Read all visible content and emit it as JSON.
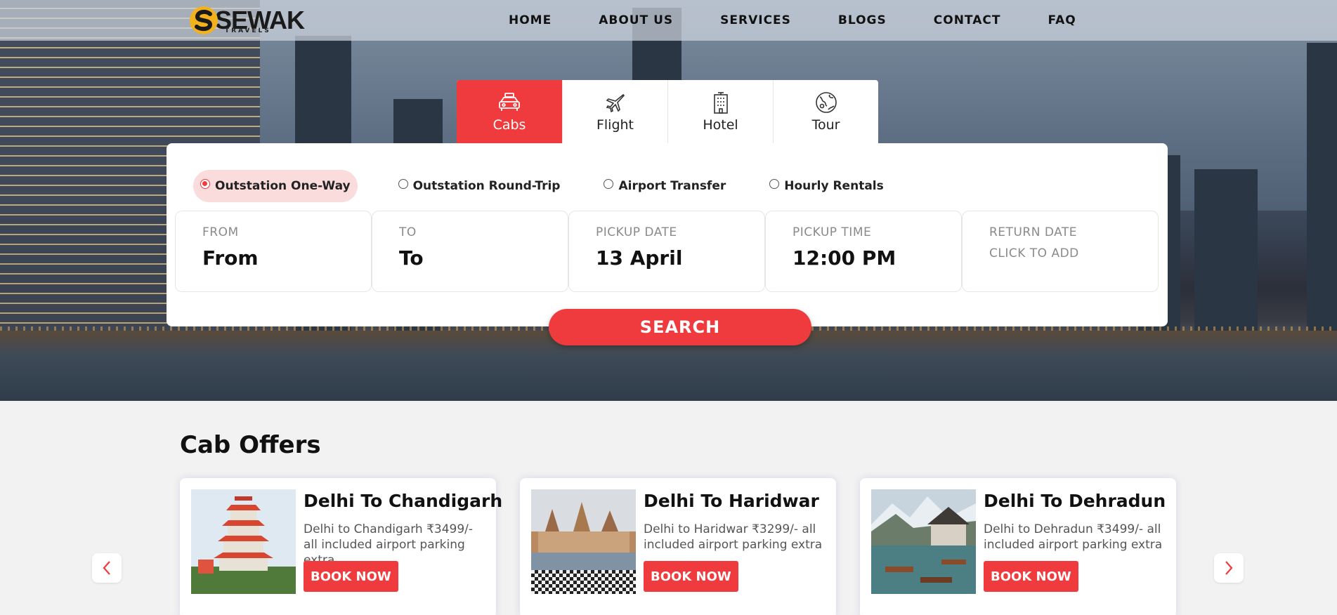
{
  "brand": {
    "name": "SEWAK",
    "tagline": "TRAVELS",
    "accent": "#ef3b3d",
    "logo_color": "#f2b21b"
  },
  "nav": {
    "items": [
      "HOME",
      "ABOUT US",
      "SERVICES",
      "BLOGS",
      "CONTACT",
      "FAQ"
    ]
  },
  "tabs": [
    {
      "label": "Cabs",
      "icon": "taxi-icon",
      "active": true
    },
    {
      "label": "Flight",
      "icon": "plane-icon",
      "active": false
    },
    {
      "label": "Hotel",
      "icon": "building-icon",
      "active": false
    },
    {
      "label": "Tour",
      "icon": "globe-icon",
      "active": false
    }
  ],
  "trip_types": [
    {
      "label": "Outstation One-Way",
      "selected": true
    },
    {
      "label": "Outstation Round-Trip",
      "selected": false
    },
    {
      "label": "Airport Transfer",
      "selected": false
    },
    {
      "label": "Hourly Rentals",
      "selected": false
    }
  ],
  "fields": {
    "from": {
      "label": "FROM",
      "value": "From"
    },
    "to": {
      "label": "TO",
      "value": "To"
    },
    "pickup_date": {
      "label": "PICKUP DATE",
      "value": "13 April"
    },
    "pickup_time": {
      "label": "PICKUP TIME",
      "value": "12:00 PM"
    },
    "return_date": {
      "label": "RETURN DATE",
      "hint": "CLICK TO ADD"
    }
  },
  "search": {
    "label": "SEARCH"
  },
  "offers": {
    "title": "Cab Offers",
    "cards": [
      {
        "title": "Delhi To Chandigarh",
        "desc": "Delhi to Chandigarh ₹3499/- all included airport parking extra",
        "button": "BOOK NOW"
      },
      {
        "title": "Delhi To Haridwar",
        "desc": "Delhi to Haridwar ₹3299/- all included airport parking extra",
        "button": "BOOK NOW"
      },
      {
        "title": "Delhi To Dehradun",
        "desc": "Delhi to Dehradun ₹3499/- all included airport parking extra",
        "button": "BOOK NOW"
      }
    ]
  }
}
